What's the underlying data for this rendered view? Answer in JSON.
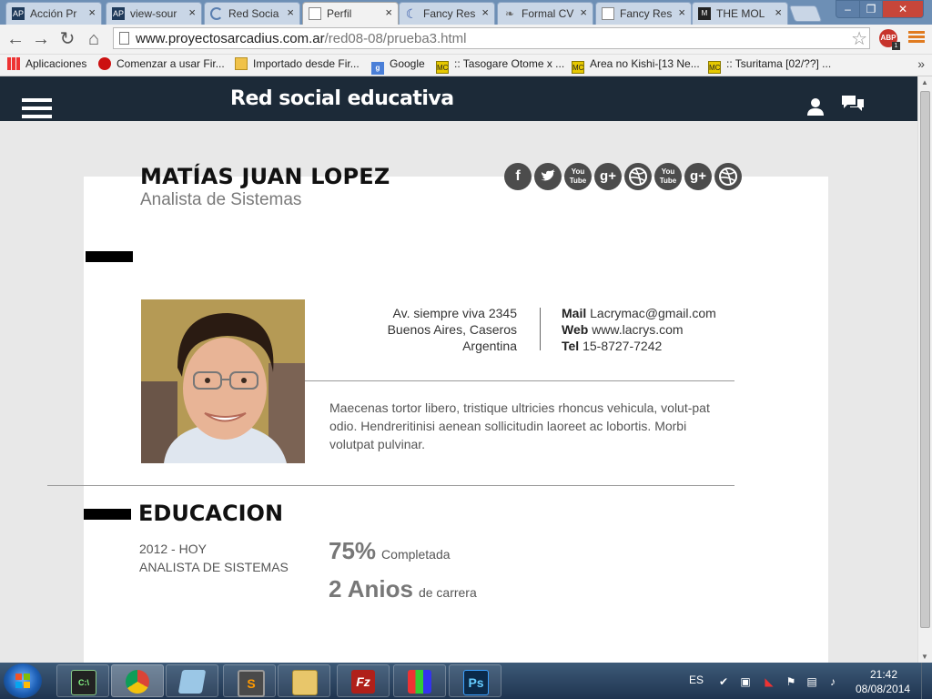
{
  "browser": {
    "tabs": [
      {
        "title": "Acción Pr",
        "icon": "ap-favicon",
        "active": false
      },
      {
        "title": "view-sour",
        "icon": "ap-favicon",
        "active": false
      },
      {
        "title": "Red Socia",
        "icon": "loading-spinner",
        "active": false
      },
      {
        "title": "Perfil",
        "icon": "page-icon",
        "active": true
      },
      {
        "title": "Fancy Res",
        "icon": "moon-favicon",
        "active": false
      },
      {
        "title": "Formal CV",
        "icon": "leaf-favicon",
        "active": false
      },
      {
        "title": "Fancy Res",
        "icon": "page-icon",
        "active": false
      },
      {
        "title": "THE MOL",
        "icon": "mol-favicon",
        "active": false
      }
    ],
    "url_host": "www.proyectosarcadius.com.ar",
    "url_path": "/red08-08/prueba3.html",
    "abp_label": "ABP",
    "abp_count": "1",
    "bookmarks": [
      {
        "label": "Aplicaciones",
        "icon": "apps-grid-icon"
      },
      {
        "label": "Comenzar a usar Fir...",
        "icon": "firefox-icon"
      },
      {
        "label": "Importado desde Fir...",
        "icon": "folder-icon"
      },
      {
        "label": "Google",
        "icon": "google-icon"
      },
      {
        "label": ":: Tasogare Otome x ...",
        "icon": "mc-icon"
      },
      {
        "label": "Area no Kishi-[13 Ne...",
        "icon": "mc-icon"
      },
      {
        "label": ":: Tsuritama [02/??] ...",
        "icon": "mc-icon"
      }
    ],
    "bookmarks_more": "»"
  },
  "site": {
    "title": "Red social educativa"
  },
  "profile": {
    "name": "MATÍAS JUAN LOPEZ",
    "role": "Analista de Sistemas",
    "social_icons": [
      "facebook-icon",
      "twitter-icon",
      "youtube-icon",
      "google-plus-icon",
      "dribbble-icon",
      "youtube-icon",
      "google-plus-icon",
      "dribbble-icon"
    ],
    "address": {
      "line1": "Av. siempre viva 2345",
      "line2": "Buenos Aires, Caseros",
      "line3": "Argentina"
    },
    "contact": {
      "mail_label": "Mail",
      "mail_value": "Lacrymac@gmail.com",
      "web_label": "Web",
      "web_value": "www.lacrys.com",
      "tel_label": "Tel",
      "tel_value": "15-8727-7242"
    },
    "bio": "Maecenas tortor libero, tristique ultricies rhoncus vehicula, volut-pat odio. Hendreritinisi aenean sollicitudin laoreet ac lobortis. Morbi volutpat pulvinar."
  },
  "education": {
    "title": "EDUCACION",
    "years": "2012 - HOY",
    "degree": "ANALISTA DE SISTEMAS",
    "progress_value": "75%",
    "progress_label": "Completada",
    "years_value": "2 Anios",
    "years_label": "de carrera"
  },
  "taskbar": {
    "apps": [
      "command-prompt-icon",
      "chrome-icon",
      "notepad-icon",
      "sublime-text-icon",
      "file-explorer-icon",
      "filezilla-icon",
      "colorcop-icon",
      "photoshop-icon"
    ],
    "filezilla_glyph": "Fz",
    "photoshop_glyph": "Ps",
    "language": "ES",
    "time": "21:42",
    "date": "08/08/2014"
  },
  "colors": {
    "site_header": "#1c2a38",
    "accent_bar": "#000000",
    "social_icon": "#4c4c4c"
  }
}
